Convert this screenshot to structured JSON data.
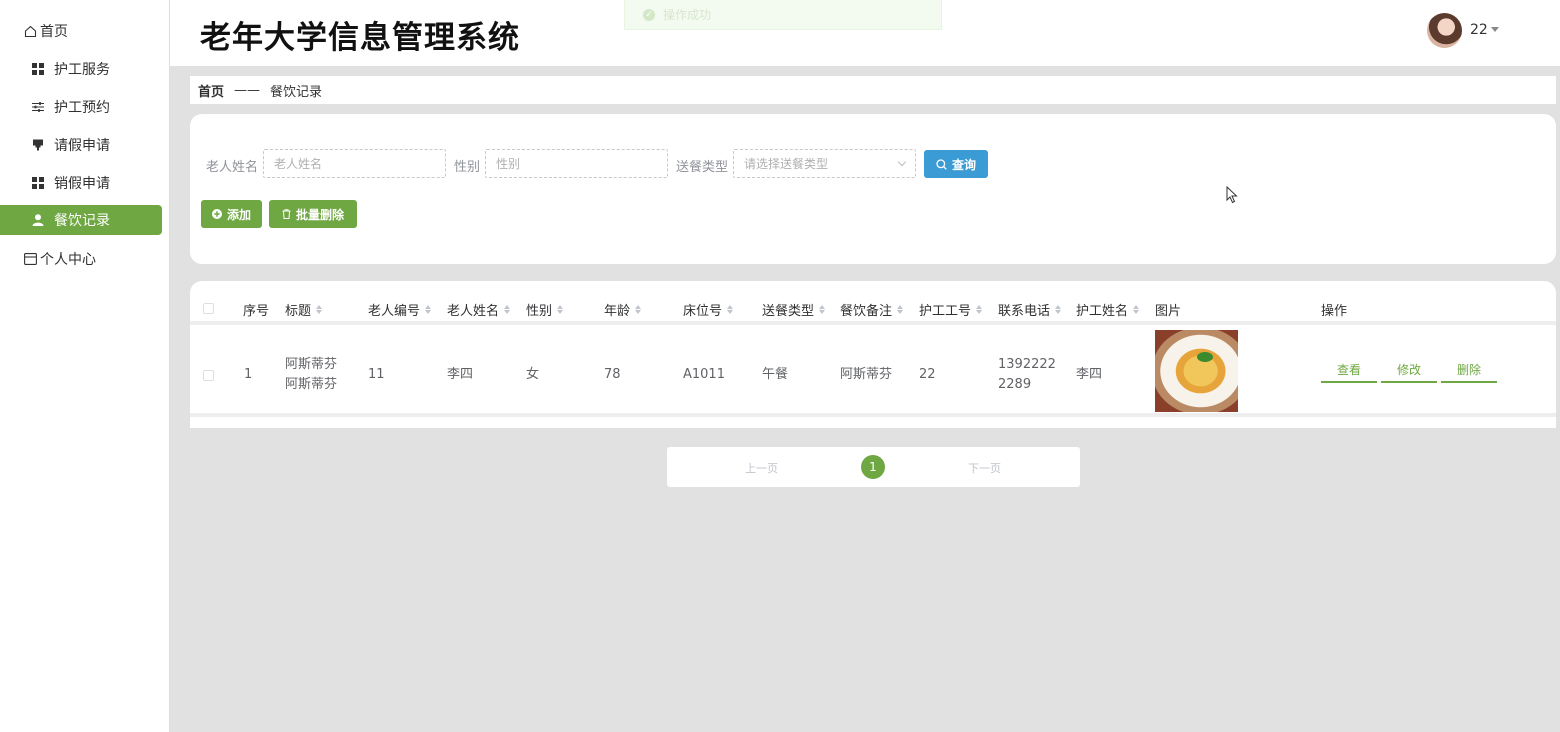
{
  "app": {
    "title": "老年大学信息管理系统"
  },
  "toast": {
    "message": "操作成功"
  },
  "user": {
    "name": "22"
  },
  "sidebar": {
    "items": [
      {
        "label": "首页",
        "icon": "home-icon"
      },
      {
        "label": "护工服务",
        "icon": "grid-icon"
      },
      {
        "label": "护工预约",
        "icon": "sliders-icon"
      },
      {
        "label": "请假申请",
        "icon": "stamp-icon"
      },
      {
        "label": "销假申请",
        "icon": "grid-icon"
      },
      {
        "label": "餐饮记录",
        "icon": "user-icon",
        "active": true
      },
      {
        "label": "个人中心",
        "icon": "card-icon"
      }
    ]
  },
  "breadcrumb": {
    "home": "首页",
    "separator": "——",
    "current": "餐饮记录"
  },
  "search": {
    "elder_name_label": "老人姓名",
    "elder_name_placeholder": "老人姓名",
    "gender_label": "性别",
    "gender_placeholder": "性别",
    "meal_type_label": "送餐类型",
    "meal_type_placeholder": "请选择送餐类型",
    "query_button": "查询"
  },
  "actions": {
    "add_button": "添加",
    "batch_delete_button": "批量删除"
  },
  "table": {
    "columns": [
      "序号",
      "标题",
      "老人编号",
      "老人姓名",
      "性别",
      "年龄",
      "床位号",
      "送餐类型",
      "餐饮备注",
      "护工工号",
      "联系电话",
      "护工姓名",
      "图片",
      "操作"
    ],
    "rows": [
      {
        "index": "1",
        "title_line1": "阿斯蒂芬",
        "title_line2": "阿斯蒂芬",
        "elder_no": "11",
        "elder_name": "李四",
        "gender": "女",
        "age": "78",
        "bed_no": "A1011",
        "meal_type": "午餐",
        "meal_note": "阿斯蒂芬",
        "nurse_no": "22",
        "phone_line1": "1392222",
        "phone_line2": "2289",
        "nurse_name": "李四",
        "ops": {
          "view": "查看",
          "edit": "修改",
          "delete": "删除"
        }
      }
    ]
  },
  "pager": {
    "prev": "上一页",
    "current": "1",
    "next": "下一页"
  },
  "colors": {
    "accent": "#6fa742",
    "query": "#3a9bd5",
    "background": "#e1e1e1"
  }
}
